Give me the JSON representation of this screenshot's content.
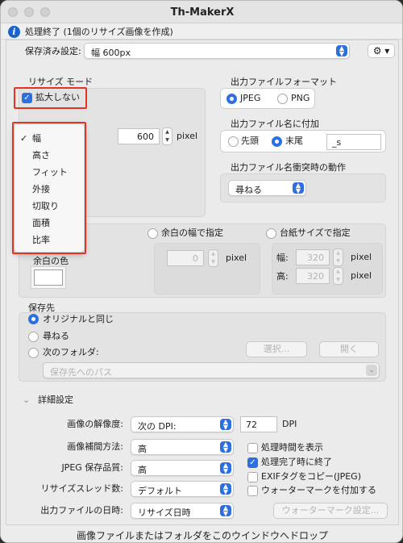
{
  "window": {
    "title": "Th-MakerX"
  },
  "status": {
    "message": "処理終了 (1個のリサイズ画像を作成)"
  },
  "preset": {
    "label": "保存済み設定:",
    "value": "幅 600px"
  },
  "resize_mode": {
    "title": "リサイズ モード",
    "no_enlarge_label": "拡大しない",
    "no_enlarge_checked": true,
    "menu_items": [
      "幅",
      "高さ",
      "フィット",
      "外接",
      "切取り",
      "面積",
      "比率"
    ],
    "menu_selected": "幅",
    "width_value": "600",
    "unit": "pixel"
  },
  "output_format": {
    "title": "出力ファイルフォーマット",
    "options": [
      "JPEG",
      "PNG"
    ],
    "selected": "JPEG"
  },
  "filename_suffix": {
    "title": "出力ファイル名に付加",
    "options": [
      "先頭",
      "末尾"
    ],
    "selected": "末尾",
    "value": "_s"
  },
  "collision": {
    "title": "出力ファイル名衝突時の動作",
    "value": "尋ねる"
  },
  "margin": {
    "option_margin_width": "余白の幅で指定",
    "option_mount_size": "台紙サイズで指定",
    "margin_value": "0",
    "unit": "pixel",
    "width_label": "幅:",
    "width_value": "320",
    "height_label": "高:",
    "height_value": "320",
    "color_label": "余白の色",
    "color": "#ffffff"
  },
  "save": {
    "title": "保存先",
    "options": [
      "オリジナルと同じ",
      "尋ねる",
      "次のフォルダ:"
    ],
    "selected": "オリジナルと同じ",
    "select_button": "選択...",
    "open_button": "開く",
    "path_placeholder": "保存先へのパス"
  },
  "advanced": {
    "title": "詳細設定",
    "resolution_label": "画像の解像度:",
    "resolution_value": "次の DPI:",
    "dpi_value": "72",
    "dpi_unit": "DPI",
    "interp_label": "画像補間方法:",
    "interp_value": "高",
    "jpeg_label": "JPEG 保存品質:",
    "jpeg_value": "高",
    "threads_label": "リサイズスレッド数:",
    "threads_value": "デフォルト",
    "date_label": "出力ファイルの日時:",
    "date_value": "リサイズ日時",
    "checkboxes": [
      {
        "label": "処理時間を表示",
        "checked": false
      },
      {
        "label": "処理完了時に終了",
        "checked": true
      },
      {
        "label": "EXIFタグをコピー(JPEG)",
        "checked": false
      },
      {
        "label": "ウォーターマークを付加する",
        "checked": false
      }
    ],
    "watermark_button": "ウォーターマーク設定..."
  },
  "footer": {
    "drop_hint": "画像ファイルまたはフォルダをこのウインドウへドロップ"
  },
  "icons": {
    "info": "info-icon",
    "gear": "gear-icon",
    "check": "checkmark-icon",
    "chevron": "chevron-down-icon"
  },
  "colors": {
    "accent": "#2d6fe0",
    "highlight": "#e53323"
  }
}
